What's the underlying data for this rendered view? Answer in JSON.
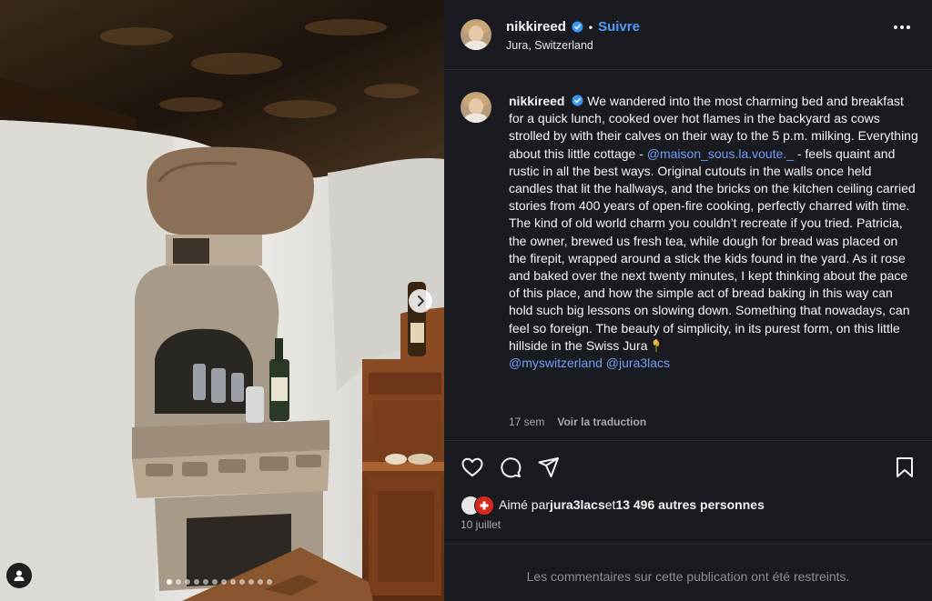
{
  "photo": {
    "alt_icon": "user-tag-icon",
    "carousel_total": 12,
    "carousel_active": 0
  },
  "header": {
    "username": "nikkireed",
    "separator": "•",
    "follow_label": "Suivre",
    "location": "Jura, Switzerland",
    "more_icon": "more-horizontal-icon"
  },
  "caption": {
    "username": "nikkireed",
    "text_part1": " We wandered into the most charming bed and breakfast for a quick lunch, cooked over hot flames in the backyard as cows strolled by with their calves on their way to the 5 p.m. milking. Everything about this little cottage - ",
    "mention1": "@maison_sous.la.voute._",
    "text_part2": " - feels quaint and rustic in all the best ways. Original cutouts in the walls once held candles that lit the hallways, and the bricks on the kitchen ceiling carried stories from 400 years of open-fire cooking, perfectly charred with time. The kind of old world charm you couldn’t recreate if you tried. Patricia, the owner, brewed us fresh tea, while dough for bread was placed on the firepit, wrapped around a stick the kids found in the yard. As it rose and baked over the next twenty minutes, I kept thinking about the pace of this place, and how the simple act of bread baking in this way can hold such big lessons on slowing down. Something that nowadays, can feel so foreign. The beauty of simplicity, in its purest form, on this little hillside in the Swiss Jura ",
    "emoji_icon": "wheat-icon",
    "mention2": "@myswitzerland",
    "mention3": "@jura3lacs"
  },
  "meta": {
    "age": "17 sem",
    "translate_label": "Voir la traduction"
  },
  "actions": {
    "like_icon": "heart-icon",
    "comment_icon": "comment-icon",
    "share_icon": "share-icon",
    "save_icon": "bookmark-icon"
  },
  "likes": {
    "prefix": "Aimé par ",
    "user": "jura3lacs",
    "middle": " et ",
    "count": "13 496 autres personnes"
  },
  "date": "10 juillet",
  "comments_restricted": "Les commentaires sur cette publication ont été restreints.",
  "colors": {
    "panel_bg": "#1a1b20",
    "link": "#6f9cf6",
    "follow": "#4f9cf9",
    "swiss_red": "#d52b1e"
  }
}
